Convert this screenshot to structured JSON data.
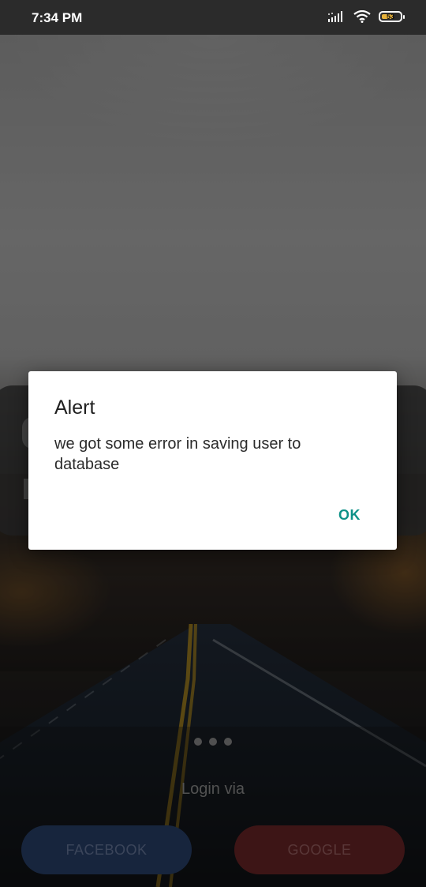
{
  "status_bar": {
    "time": "7:34 PM",
    "battery_level": "53",
    "icons": [
      "signal-icon",
      "wifi-icon",
      "battery-icon"
    ]
  },
  "background": {
    "pager_dots": 3,
    "login_via": "Login via",
    "facebook_label": "FACEBOOK",
    "google_label": "GOOGLE",
    "colors": {
      "facebook": "#29406a",
      "google": "#6a2526"
    }
  },
  "dialog": {
    "title": "Alert",
    "message": "we got some error in saving user to database",
    "ok_label": "OK",
    "accent": "#0e9188"
  }
}
